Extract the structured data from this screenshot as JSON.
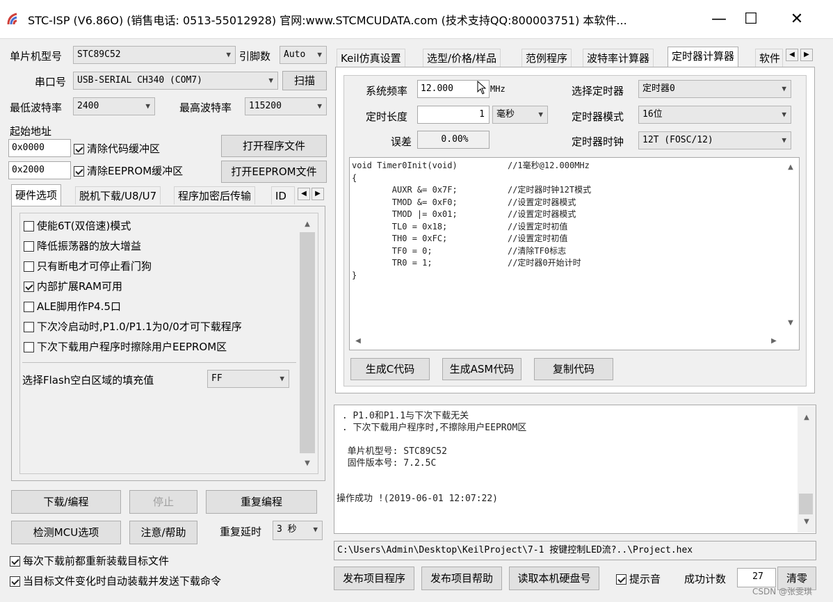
{
  "window": {
    "title": "STC-ISP (V6.86O) (销售电话: 0513-55012928) 官网:www.STCMCUDATA.com  (技术支持QQ:800003751) 本软件...",
    "minimize": "—",
    "maximize": "☐",
    "close": "✕"
  },
  "left": {
    "mcu_label": "单片机型号",
    "mcu_value": "STC89C52",
    "pin_label": "引脚数",
    "pin_value": "Auto",
    "port_label": "串口号",
    "port_value": "USB-SERIAL CH340 (COM7)",
    "scan_button": "扫描",
    "min_baud_label": "最低波特率",
    "min_baud_value": "2400",
    "max_baud_label": "最高波特率",
    "max_baud_value": "115200",
    "start_addr_label": "起始地址",
    "addr1_value": "0x0000",
    "clear_code_label": "清除代码缓冲区",
    "open_program_button": "打开程序文件",
    "addr2_value": "0x2000",
    "clear_eeprom_label": "清除EEPROM缓冲区",
    "open_eeprom_button": "打开EEPROM文件",
    "tabs": [
      "硬件选项",
      "脱机下载/U8/U7",
      "程序加密后传输",
      "ID"
    ],
    "options": [
      {
        "label": "使能6T(双倍速)模式",
        "checked": false
      },
      {
        "label": "降低振荡器的放大增益",
        "checked": false
      },
      {
        "label": "只有断电才可停止看门狗",
        "checked": false
      },
      {
        "label": "内部扩展RAM可用",
        "checked": true
      },
      {
        "label": "ALE脚用作P4.5口",
        "checked": false
      },
      {
        "label": "下次冷启动时,P1.0/P1.1为0/0才可下载程序",
        "checked": false
      },
      {
        "label": "下次下载用户程序时擦除用户EEPROM区",
        "checked": false
      }
    ],
    "fill_label": "选择Flash空白区域的填充值",
    "fill_value": "FF",
    "download_button": "下载/编程",
    "stop_button": "停止",
    "reprogram_button": "重复编程",
    "detect_button": "检测MCU选项",
    "help_button": "注意/帮助",
    "repeat_delay_label": "重复延时",
    "repeat_delay_value": "3 秒",
    "reload_label": "每次下载前都重新装载目标文件",
    "autoload_label": "当目标文件变化时自动装载并发送下载命令"
  },
  "right": {
    "tabs": [
      "Keil仿真设置",
      "选型/价格/样品",
      "范例程序",
      "波特率计算器",
      "定时器计算器",
      "软件"
    ],
    "active_tab": "定时器计算器",
    "sysfreq_label": "系统频率",
    "sysfreq_value": "12.000",
    "sysfreq_unit": "MHz",
    "select_timer_label": "选择定时器",
    "select_timer_value": "定时器0",
    "length_label": "定时长度",
    "length_value": "1",
    "length_unit": "毫秒",
    "timer_mode_label": "定时器模式",
    "timer_mode_value": "16位",
    "error_label": "误差",
    "error_value": "0.00%",
    "timer_clock_label": "定时器时钟",
    "timer_clock_value": "12T (FOSC/12)",
    "code_lines": [
      "void Timer0Init(void)          //1毫秒@12.000MHz",
      "{",
      "        AUXR &= 0x7F;          //定时器时钟12T模式",
      "        TMOD &= 0xF0;          //设置定时器模式",
      "        TMOD |= 0x01;          //设置定时器模式",
      "        TL0 = 0x18;            //设置定时初值",
      "        TH0 = 0xFC;            //设置定时初值",
      "        TF0 = 0;               //清除TF0标志",
      "        TR0 = 1;               //定时器0开始计时",
      "}"
    ],
    "gen_c_button": "生成C代码",
    "gen_asm_button": "生成ASM代码",
    "copy_button": "复制代码"
  },
  "log": {
    "lines": [
      " . P1.0和P1.1与下次下载无关",
      " . 下次下载用户程序时,不擦除用户EEPROM区",
      "",
      "  单片机型号: STC89C52",
      "  固件版本号: 7.2.5C",
      "",
      "",
      "操作成功 !(2019-06-01 12:07:22)"
    ]
  },
  "bottom": {
    "path": "C:\\Users\\Admin\\Desktop\\KeilProject\\7-1 按键控制LED流?..\\Project.hex",
    "publish_program_button": "发布项目程序",
    "publish_help_button": "发布项目帮助",
    "read_disk_button": "读取本机硬盘号",
    "prompt_label": "提示音",
    "success_count_label": "成功计数",
    "success_count_value": "27",
    "clear_button": "清零"
  },
  "watermark": "CSDN @张雯琪"
}
